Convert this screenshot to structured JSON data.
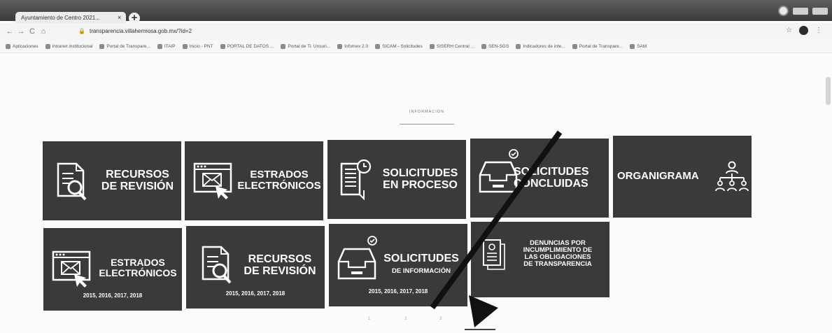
{
  "browser": {
    "tab_title": "Ayuntamiento de Centro 2021...",
    "tab_close": "×",
    "new_tab": "+",
    "nav_back": "←",
    "nav_forward": "→",
    "nav_reload": "C",
    "nav_home": "⌂",
    "url": "transparencia.villahermosa.gob.mx/?id=2",
    "star": "☆",
    "bookmarks": [
      "Aplicaciones",
      "Intranet institucional",
      "Portal de Transpare...",
      "ITAIP",
      "Inicio - PNT",
      "PORTAL DE DATOS ...",
      "Portal de Ti: Unsuri...",
      "Infomex 2.0",
      "SICAM - Solicitudes",
      "SISERH Central ...",
      "SEN-SGS",
      "Indicadores de inte...",
      "Portal de Transpare...",
      "SAM"
    ]
  },
  "page": {
    "section_label": "INFORMACIÓN",
    "tiles": [
      {
        "line1": "RECURSOS",
        "line2": "DE REVISIÓN",
        "icon": "document-search-icon"
      },
      {
        "line1": "ESTRADOS",
        "line2": "ELECTRÓNICOS",
        "icon": "browser-mail-icon"
      },
      {
        "line1": "SOLICITUDES",
        "line2": "EN PROCESO",
        "icon": "document-clock-icon"
      },
      {
        "line1": "SOLICITUDES",
        "line2": "CONCLUIDAS",
        "icon": "inbox-check-icon"
      },
      {
        "line1": "ORGANIGRAMA",
        "icon": "org-chart-icon"
      },
      {
        "line1": "ESTRADOS",
        "line2": "ELECTRÓNICOS",
        "years": "2015, 2016, 2017, 2018",
        "icon": "browser-mail-icon"
      },
      {
        "line1": "RECURSOS",
        "line2": "DE REVISIÓN",
        "years": "2015, 2016, 2017, 2018",
        "icon": "document-search-icon"
      },
      {
        "line1": "SOLICITUDES",
        "line2": "DE INFORMACIÓN",
        "years": "2015, 2016, 2017, 2018",
        "icon": "inbox-check-icon"
      },
      {
        "line1": "DENUNCIAS POR",
        "line2": "INCUMPLIMIENTO DE",
        "line3": "LAS OBLIGACIONES",
        "line4": "DE TRANSPARENCIA",
        "icon": "certificate-icon"
      }
    ],
    "pager": [
      "1",
      "2",
      "3",
      "4"
    ]
  },
  "colors": {
    "tile_bg": "#3a3a3a",
    "arrow": "#111111"
  }
}
